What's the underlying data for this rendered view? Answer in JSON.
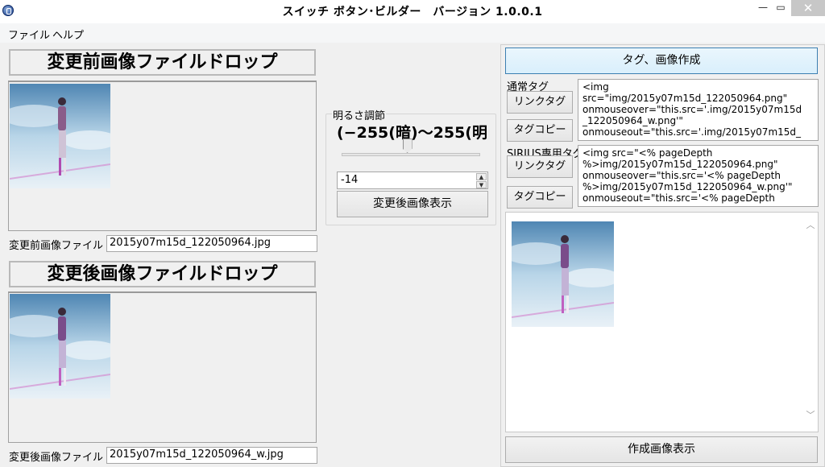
{
  "window": {
    "title": "スイッチ ボタン･ビルダー　バージョン 1.0.0.1",
    "minimize_glyph": "—",
    "maximize_glyph": "▭",
    "close_glyph": "✕"
  },
  "menu": {
    "items": [
      {
        "label": "ファイル"
      },
      {
        "label": "ヘルプ"
      }
    ]
  },
  "left": {
    "before_title": "変更前画像ファイルドロップ",
    "before_label": "変更前画像ファイル",
    "before_file": "2015y07m15d_122050964.jpg",
    "after_title": "変更後画像ファイルドロップ",
    "after_label": "変更後画像ファイル",
    "after_file": "2015y07m15d_122050964_w.jpg"
  },
  "brightness": {
    "group_label": "明るさ調節",
    "range_text": "(−255(暗)～255(明",
    "slider_value": -14,
    "slider_min": -255,
    "slider_max": 255,
    "spin_value": "-14",
    "show_button": "変更後画像表示"
  },
  "right": {
    "create_button": "タグ、画像作成",
    "normal_label": "通常タグ",
    "normal_link_button": "リンクタグ",
    "normal_copy_button": "タグコピー",
    "normal_code": "<img\nsrc=\"img/2015y07m15d_122050964.png\"\nonmouseover=\"this.src='.img/2015y07m15d\n_122050964_w.png'\"\nonmouseout=\"this.src='.img/2015y07m15d_",
    "sirius_label": "SIRIUS専用タグ",
    "sirius_link_button": "リンクタグ",
    "sirius_copy_button": "タグコピー",
    "sirius_code": "<img src=\"<% pageDepth\n%>img/2015y07m15d_122050964.png\"\nonmouseover=\"this.src='<% pageDepth\n%>img/2015y07m15d_122050964_w.png'\"\nonmouseout=\"this.src='<% pageDepth",
    "bottom_button": "作成画像表示"
  },
  "icons": {
    "scroll_up": "scroll-up-icon",
    "scroll_down": "scroll-down-icon",
    "app": "app-icon"
  }
}
